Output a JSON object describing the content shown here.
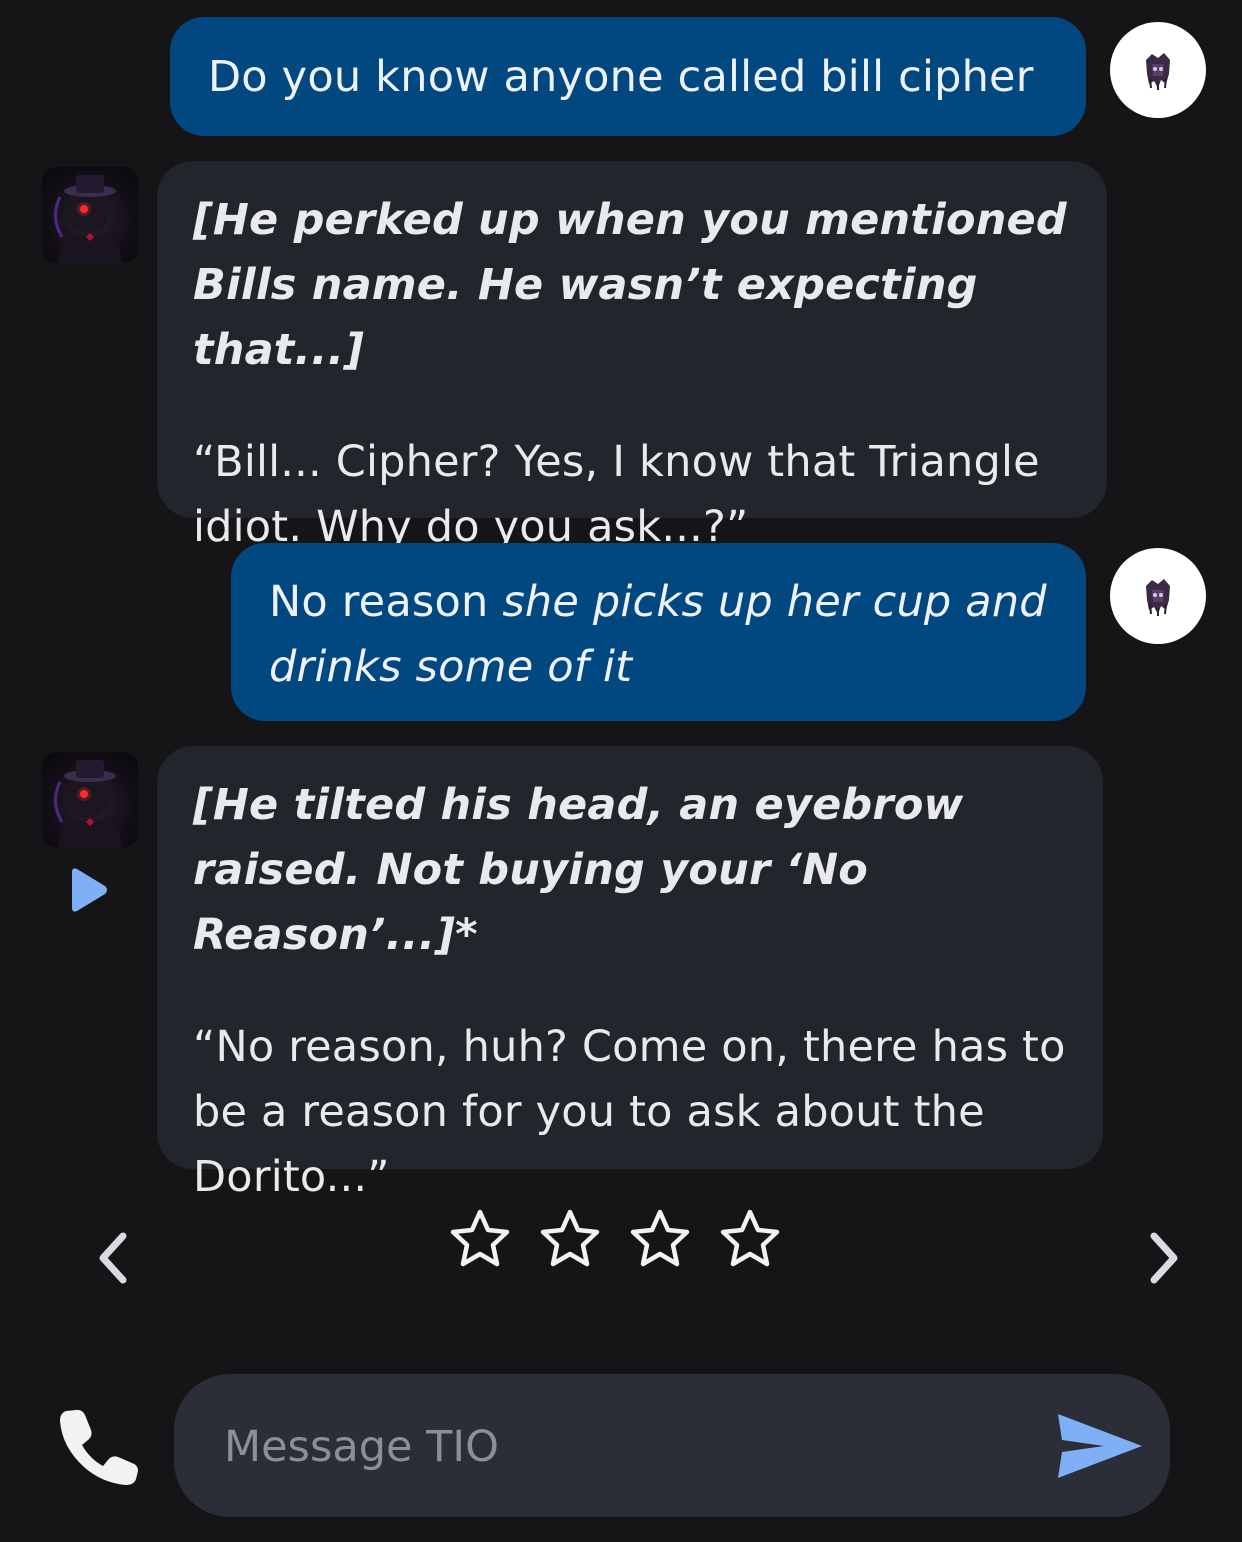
{
  "messages": [
    {
      "role": "user",
      "plain": "Do you know anyone called bill cipher"
    },
    {
      "role": "character",
      "narration": "[He perked up when you mentioned Bills name. He wasn’t expecting that...]",
      "speech": "“Bill... Cipher? Yes, I know that Triangle idiot. Why do you ask...?”"
    },
    {
      "role": "user",
      "plain": "No reason",
      "action": "she picks up her cup and drinks some of it"
    },
    {
      "role": "character",
      "narration": "[He tilted his head, an eyebrow raised. Not buying your ‘No Reason’...]*",
      "speech": "“No reason, huh? Come on, there has to be a reason for you to ask about the Dorito...”"
    }
  ],
  "rating": {
    "stars_total": 4,
    "stars_filled": 0
  },
  "composer": {
    "placeholder": "Message TIO",
    "value": ""
  },
  "icons": {
    "previous": "chevron-left-icon",
    "next": "chevron-right-icon",
    "call": "phone-icon",
    "send": "send-icon",
    "play": "play-icon",
    "star": "star-outline-icon"
  },
  "colors": {
    "background": "#151517",
    "user_bubble": "#014880",
    "bot_bubble": "#22252b",
    "input_bg": "#2b2e36",
    "accent": "#7fb0f5"
  }
}
